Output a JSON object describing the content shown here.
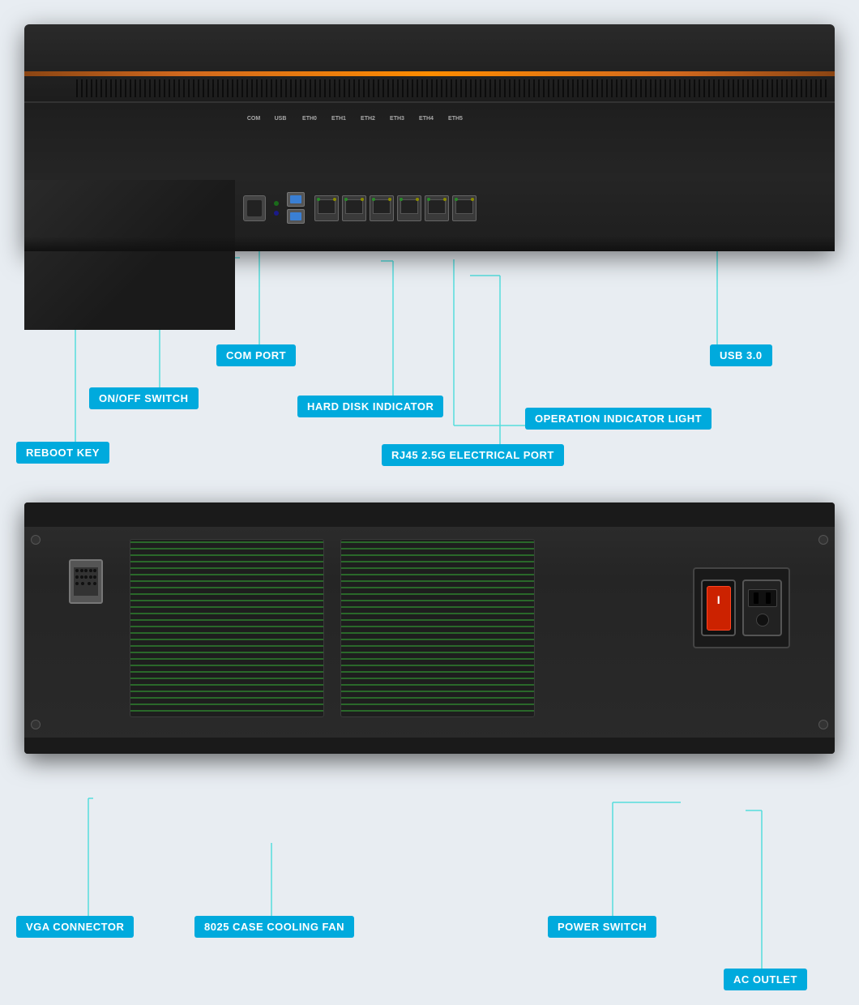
{
  "background_color": "#e8edf2",
  "top_device": {
    "labels": {
      "com_port": "COM PORT",
      "on_off_switch": "ON/OFF SWITCH",
      "reboot_key": "REBOOT KEY",
      "hard_disk_indicator": "HARD DISK INDICATOR",
      "operation_indicator_light": "OPERATION INDICATOR LIGHT",
      "usb_3": "USB 3.0",
      "rj45": "RJ45 2.5G ELECTRICAL PORT"
    },
    "eth_labels": [
      "ETH0",
      "ETH1",
      "ETH2",
      "ETH3",
      "ETH4",
      "ETH5"
    ]
  },
  "bottom_device": {
    "labels": {
      "vga_connector": "VGA  CONNECTOR",
      "cooling_fan": "8025 CASE COOLING FAN",
      "power_switch": "POWER  SWITCH",
      "ac_outlet": "AC  OUTLET"
    }
  }
}
